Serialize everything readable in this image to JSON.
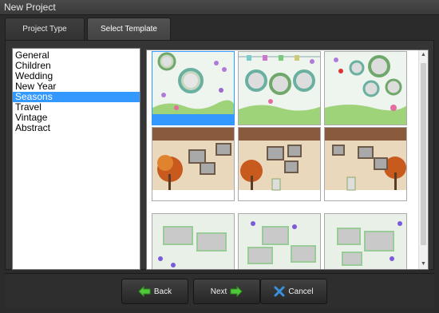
{
  "window": {
    "title": "New Project"
  },
  "tabs": [
    {
      "label": "Project Type",
      "active": false
    },
    {
      "label": "Select Template",
      "active": true
    }
  ],
  "categories": {
    "items": [
      "General",
      "Children",
      "Wedding",
      "New Year",
      "Seasons",
      "Travel",
      "Vintage",
      "Abstract"
    ],
    "selected": "Seasons"
  },
  "templates": {
    "rows": [
      [
        "spring-garden-1",
        "spring-garden-2",
        "spring-garden-3"
      ],
      [
        "autumn-leaves-1",
        "autumn-leaves-2",
        "autumn-leaves-3"
      ],
      [
        "winter-frost-1",
        "winter-frost-2",
        "winter-frost-3"
      ]
    ],
    "selected": "spring-garden-1"
  },
  "buttons": {
    "back": "Back",
    "next": "Next",
    "cancel": "Cancel"
  },
  "colors": {
    "selection": "#3399ff",
    "arrow_green": "#4fc83a",
    "cancel_blue": "#3a8fe0"
  }
}
